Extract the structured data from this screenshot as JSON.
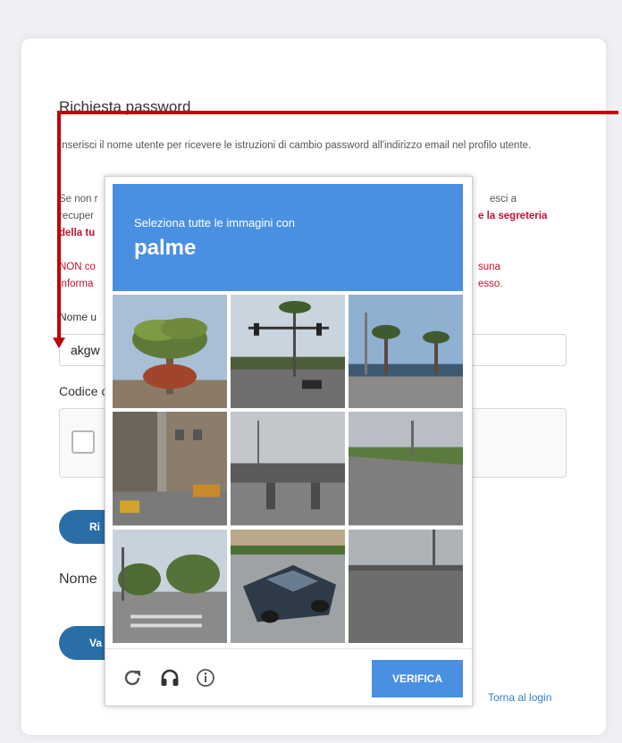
{
  "form": {
    "title": "Richiesta password",
    "desc": "Inserisci il nome utente per ricevere le istruzioni di cambio password all'indirizzo email nel profilo utente.",
    "frag_left1": "Se non r",
    "frag_left2": "recuper",
    "frag_left3": "della tu",
    "frag_right1": "esci a",
    "frag_right2": "e la segreteria",
    "frag_left4": "NON co",
    "frag_left5": "informa",
    "frag_right3": "suna",
    "frag_right4": "esso.",
    "username_label": "Nome u",
    "username_value": "akgw",
    "codice_label": "Codice c",
    "button1_label": "Ri",
    "nome_label": "Nome",
    "button2_label": "Va",
    "back_link": "Torna al login"
  },
  "captcha": {
    "instruction": "Seleziona tutte le immagini con",
    "target": "palme",
    "verify_label": "VERIFICA",
    "tiles": [
      {
        "label": "palm-tree-closeup"
      },
      {
        "label": "traffic-light-palms"
      },
      {
        "label": "palms-street"
      },
      {
        "label": "building-street"
      },
      {
        "label": "overpass"
      },
      {
        "label": "empty-road"
      },
      {
        "label": "intersection-trees"
      },
      {
        "label": "car-parking-lot"
      },
      {
        "label": "road-fence"
      }
    ]
  },
  "colors": {
    "accent": "#4a90e2",
    "primary_button": "#2a6ea8",
    "link": "#3a7bc8",
    "annotation": "#c00000",
    "warning_text": "#c8102e"
  }
}
